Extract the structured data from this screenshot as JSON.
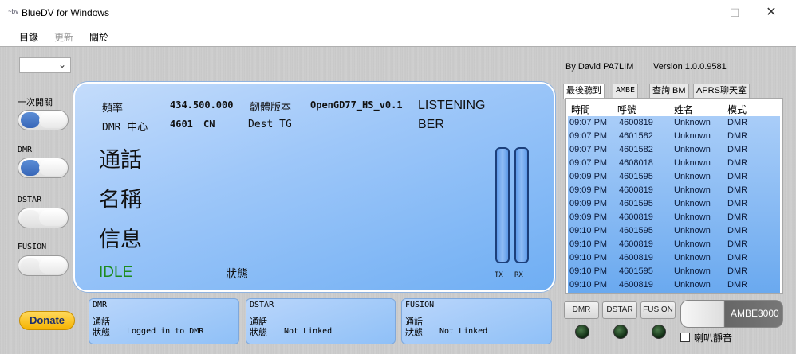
{
  "window": {
    "app_icon_text": "~bv",
    "title": "BlueDV for Windows",
    "minimize": "—",
    "maximize": "☐",
    "close": "✕"
  },
  "menu": [
    {
      "label": "目錄",
      "enabled": true
    },
    {
      "label": "更新",
      "enabled": false
    },
    {
      "label": "關於",
      "enabled": true
    }
  ],
  "sidebar": {
    "combo_value": "",
    "combo_arrow": "⌄",
    "labels": {
      "first_switch": "一次開關",
      "dmr": "DMR",
      "dstar": "DSTAR",
      "fusion": "FUSION"
    },
    "toggles": {
      "first_switch": true,
      "dmr": true,
      "dstar": false,
      "fusion": false
    },
    "donate": "Donate"
  },
  "display": {
    "freq_label": "頻率",
    "freq_value": "434.500.000",
    "firmware_label": "韌體版本",
    "firmware_value": "OpenGD77_HS_v0.1",
    "listening": "LISTENING",
    "ber": "BER",
    "dmr_center_label": "DMR 中心",
    "dmr_center_value": "4601",
    "dmr_center_country": "CN",
    "dest_tg": "Dest TG",
    "call_label": "通話",
    "name_label": "名稱",
    "info_label": "信息",
    "idle": "IDLE",
    "status_label": "狀態",
    "tx": "TX",
    "rx": "RX"
  },
  "about": {
    "author": "By David PA7LIM",
    "version": "Version 1.0.0.9581"
  },
  "tabs": [
    {
      "label": "最後聽到",
      "active": true
    },
    {
      "label": "AMBE",
      "active": false
    },
    {
      "label": "查詢 BM",
      "active": false
    },
    {
      "label": "APRS聊天室",
      "active": false
    }
  ],
  "heard": {
    "columns": [
      "時間",
      "呼號",
      "姓名",
      "模式"
    ],
    "rows": [
      [
        "09:07 PM",
        "4600819",
        "Unknown",
        "DMR"
      ],
      [
        "09:07 PM",
        "4601582",
        "Unknown",
        "DMR"
      ],
      [
        "09:07 PM",
        "4601582",
        "Unknown",
        "DMR"
      ],
      [
        "09:07 PM",
        "4608018",
        "Unknown",
        "DMR"
      ],
      [
        "09:09 PM",
        "4601595",
        "Unknown",
        "DMR"
      ],
      [
        "09:09 PM",
        "4600819",
        "Unknown",
        "DMR"
      ],
      [
        "09:09 PM",
        "4601595",
        "Unknown",
        "DMR"
      ],
      [
        "09:09 PM",
        "4600819",
        "Unknown",
        "DMR"
      ],
      [
        "09:10 PM",
        "4601595",
        "Unknown",
        "DMR"
      ],
      [
        "09:10 PM",
        "4600819",
        "Unknown",
        "DMR"
      ],
      [
        "09:10 PM",
        "4600819",
        "Unknown",
        "DMR"
      ],
      [
        "09:10 PM",
        "4601595",
        "Unknown",
        "DMR"
      ],
      [
        "09:10 PM",
        "4600819",
        "Unknown",
        "DMR"
      ]
    ]
  },
  "networks": [
    {
      "name": "DMR",
      "call_label": "通話",
      "status_label": "狀態",
      "status": "Logged in to DMR"
    },
    {
      "name": "DSTAR",
      "call_label": "通話",
      "status_label": "狀態",
      "status": "Not Linked"
    },
    {
      "name": "FUSION",
      "call_label": "通話",
      "status_label": "狀態",
      "status": "Not Linked"
    }
  ],
  "mode_buttons": [
    "DMR",
    "DSTAR",
    "FUSION"
  ],
  "ambe_button": "AMBE3000",
  "mute": {
    "label": "喇叭靜音",
    "checked": false
  }
}
